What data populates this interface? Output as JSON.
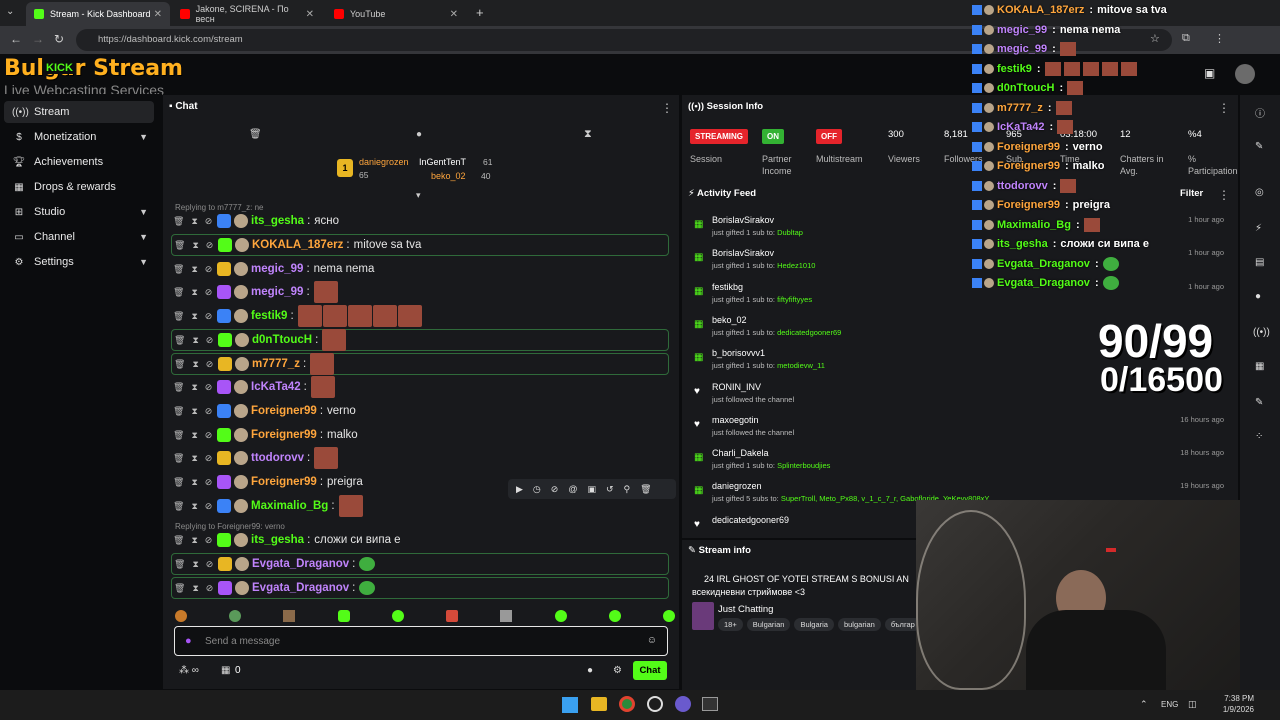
{
  "browser": {
    "tabs": [
      {
        "label": "Stream - Kick Dashboard",
        "active": true
      },
      {
        "label": "Jakone, SCIRENA - По весн",
        "active": false
      },
      {
        "label": "YouTube",
        "active": false
      }
    ],
    "url": "https://dashboard.kick.com/stream"
  },
  "brand": {
    "logo_text": "Bulgar Stream",
    "logo_sub": "Live Webcasting Services",
    "logo_kick": "KICK"
  },
  "sidebar": {
    "items": [
      {
        "label": "Stream",
        "icon": "broadcast-icon",
        "active": true
      },
      {
        "label": "Monetization",
        "icon": "dollar-icon"
      },
      {
        "label": "Achievements",
        "icon": "trophy-icon"
      },
      {
        "label": "Drops & rewards",
        "icon": "gift-icon"
      },
      {
        "label": "Studio",
        "icon": "grid-icon"
      },
      {
        "label": "Channel",
        "icon": "tv-icon"
      },
      {
        "label": "Settings",
        "icon": "gear-icon"
      }
    ]
  },
  "chat": {
    "title": "Chat",
    "leaderboard": [
      {
        "rank": "1",
        "name": "daniegrozen",
        "count": "65"
      },
      {
        "name": "InGentTenT",
        "count": "61"
      },
      {
        "name": "beko_02",
        "count": "40"
      }
    ],
    "reply_top": "Replying to m7777_z: ne",
    "messages": [
      {
        "user": "its_gesha",
        "text": "ясно",
        "color": "#53fc18"
      },
      {
        "user": "KOKALA_187erz",
        "text": "mitove sa tva",
        "color": "#ffa63d",
        "hl": true
      },
      {
        "user": "megic_99",
        "text": "nema nema",
        "color": "#c084fc"
      },
      {
        "user": "megic_99",
        "text": "",
        "color": "#c084fc"
      },
      {
        "user": "festik9",
        "text": "",
        "color": "#53fc18"
      },
      {
        "user": "d0nTtoucH",
        "text": "",
        "color": "#53fc18",
        "hl": true
      },
      {
        "user": "m7777_z",
        "text": "",
        "color": "#ffa63d",
        "hl": true
      },
      {
        "user": "IcKaTa42",
        "text": "",
        "color": "#c084fc"
      },
      {
        "user": "Foreigner99",
        "text": "verno",
        "color": "#ffa63d"
      },
      {
        "user": "Foreigner99",
        "text": "malko",
        "color": "#ffa63d"
      },
      {
        "user": "ttodorovv",
        "text": "",
        "color": "#c084fc"
      },
      {
        "user": "Foreigner99",
        "text": "preigra",
        "color": "#ffa63d"
      },
      {
        "user": "Maximalio_Bg",
        "text": "",
        "color": "#53fc18"
      },
      {
        "user": "its_gesha",
        "text": "сложи си випа е",
        "color": "#53fc18"
      },
      {
        "user": "Evgata_Draganov",
        "text": "",
        "color": "#c084fc",
        "hl": true
      },
      {
        "user": "Evgata_Draganov",
        "text": "",
        "color": "#c084fc",
        "hl": true
      }
    ],
    "reply_mid": "Replying to Foreigner99: verno",
    "input_placeholder": "Send a message",
    "send_label": "Chat",
    "points": "0"
  },
  "session": {
    "title": "Session Info",
    "stats": [
      {
        "value": "STREAMING",
        "label": "Session",
        "pill": "#e5242b"
      },
      {
        "value": "ON",
        "label": "Partner Income",
        "pill": "#33b233"
      },
      {
        "value": "OFF",
        "label": "Multistream",
        "pill": "#e5242b"
      },
      {
        "value": "300",
        "label": "Viewers"
      },
      {
        "value": "8,181",
        "label": "Followers"
      },
      {
        "value": "965",
        "label": "Sub"
      },
      {
        "value": "03:18:00",
        "label": "Time"
      },
      {
        "value": "12",
        "label": "Chatters in Avg."
      },
      {
        "value": "%4",
        "label": "% Participation"
      }
    ]
  },
  "activity": {
    "title": "Activity Feed",
    "filter": "Filter",
    "items": [
      {
        "user": "BorislavSirakov",
        "pre": "just gifted 1 sub to:",
        "target": "Dubltap",
        "time": "1 hour ago",
        "type": "gift"
      },
      {
        "user": "BorislavSirakov",
        "pre": "just gifted 1 sub to:",
        "target": "Hedez1010",
        "time": "1 hour ago",
        "type": "gift"
      },
      {
        "user": "festikbg",
        "pre": "just gifted 1 sub to:",
        "target": "fiftyfiftyyes",
        "time": "1 hour ago",
        "type": "gift"
      },
      {
        "user": "beko_02",
        "pre": "just gifted 1 sub to:",
        "target": "dedicatedgooner69",
        "time": "",
        "type": "gift"
      },
      {
        "user": "b_borisovvv1",
        "pre": "just gifted 1 sub to:",
        "target": "metodievw_11",
        "time": "",
        "type": "gift"
      },
      {
        "user": "RONIN_INV",
        "pre": "just followed the channel",
        "target": "",
        "time": "",
        "type": "follow"
      },
      {
        "user": "maxoegotin",
        "pre": "just followed the channel",
        "target": "",
        "time": "16 hours ago",
        "type": "follow"
      },
      {
        "user": "Charli_Dakela",
        "pre": "just gifted 1 sub to:",
        "target": "Splinterboudjies",
        "time": "18 hours ago",
        "type": "gift"
      },
      {
        "user": "daniegrozen",
        "pre": "just gifted 5 subs to:",
        "target": "SuperTroll, Meto_Px88, v_1_c_7_r, Gabofloride, YeKeyy808xY",
        "time": "19 hours ago",
        "type": "gift"
      },
      {
        "user": "dedicatedgooner69",
        "pre": "",
        "target": "",
        "time": "",
        "type": "follow"
      }
    ]
  },
  "stream_info": {
    "title": "Stream info",
    "stream_title": "24 IRL GHOST OF YOTEI STREAM S BONUSI AN",
    "stream_title2": "всекидневни стриймове <3",
    "category": "Just Chatting",
    "tags": [
      "18+",
      "Bulgarian",
      "Bulgaria",
      "bulgarian",
      "българ"
    ]
  },
  "overlay": {
    "goal_top": "90/99",
    "goal_bottom": "0/16500",
    "lines": [
      {
        "user": "KOKALA_187erz",
        "text": "mitove sa tva",
        "color": "#ffa63d"
      },
      {
        "user": "megic_99",
        "text": "nema nema",
        "color": "#c084fc"
      },
      {
        "user": "megic_99",
        "text": "",
        "color": "#c084fc"
      },
      {
        "user": "festik9",
        "text": "",
        "color": "#53fc18"
      },
      {
        "user": "d0nTtoucH",
        "text": "",
        "color": "#53fc18"
      },
      {
        "user": "m7777_z",
        "text": "",
        "color": "#ffa63d"
      },
      {
        "user": "IcKaTa42",
        "text": "",
        "color": "#c084fc"
      },
      {
        "user": "Foreigner99",
        "text": "verno",
        "color": "#ffa63d"
      },
      {
        "user": "Foreigner99",
        "text": "malko",
        "color": "#ffa63d"
      },
      {
        "user": "ttodorovv",
        "text": "",
        "color": "#c084fc"
      },
      {
        "user": "Foreigner99",
        "text": "preigra",
        "color": "#ffa63d"
      },
      {
        "user": "Maximalio_Bg",
        "text": "",
        "color": "#53fc18"
      },
      {
        "user": "its_gesha",
        "text": "сложи си випа е",
        "color": "#53fc18"
      },
      {
        "user": "Evgata_Draganov",
        "text": "",
        "color": "#53fc18"
      },
      {
        "user": "Evgata_Draganov",
        "text": "",
        "color": "#53fc18"
      }
    ]
  },
  "taskbar": {
    "lang": "ENG",
    "time": "7:38 PM",
    "date": "1/9/2026"
  },
  "colors": {
    "accent": "#53fc18",
    "panel": "#18191c",
    "bg": "#0b0c0e"
  }
}
